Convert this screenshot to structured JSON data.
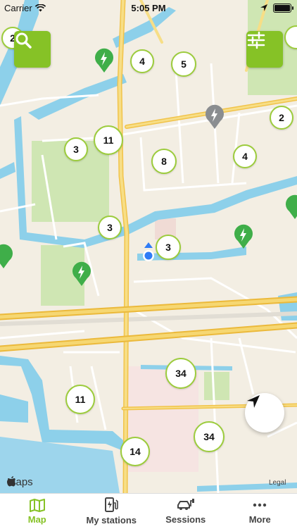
{
  "status": {
    "carrier": "Carrier",
    "time": "5:05 PM"
  },
  "map": {
    "brand": "Maps",
    "legal": "Legal",
    "clusters": [
      {
        "count": "2"
      },
      {
        "count": "4"
      },
      {
        "count": "5"
      },
      {
        "count": "11"
      },
      {
        "count": "3"
      },
      {
        "count": "8"
      },
      {
        "count": "4"
      },
      {
        "count": "2"
      },
      {
        "count": "3"
      },
      {
        "count": "3"
      },
      {
        "count": "34"
      },
      {
        "count": "11"
      },
      {
        "count": "34"
      },
      {
        "count": "14"
      }
    ]
  },
  "buttons": {
    "search_icon": "search-icon",
    "filter_icon": "filter-icon",
    "locate_icon": "navigation-arrow-icon"
  },
  "tabs": [
    {
      "label": "Map",
      "icon": "map-icon",
      "active": true
    },
    {
      "label": "My stations",
      "icon": "charging-station-icon",
      "active": false
    },
    {
      "label": "Sessions",
      "icon": "car-charging-icon",
      "active": false
    },
    {
      "label": "More",
      "icon": "more-dots-icon",
      "active": false
    }
  ],
  "colors": {
    "accent": "#86c226",
    "water": "#8dd0ea",
    "park": "#cfe6b3",
    "road_major": "#f5d66c"
  }
}
